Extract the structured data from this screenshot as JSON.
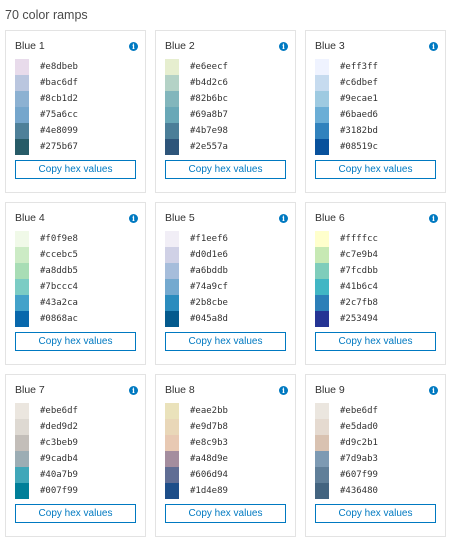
{
  "heading": "70 color ramps",
  "copy_label": "Copy hex values",
  "ramps": [
    {
      "name": "Blue 1",
      "colors": [
        "#e8dbeb",
        "#bac6df",
        "#8cb1d2",
        "#75a6cc",
        "#4e8099",
        "#275b67"
      ]
    },
    {
      "name": "Blue 2",
      "colors": [
        "#e6eecf",
        "#b4d2c6",
        "#82b6bc",
        "#69a8b7",
        "#4b7e98",
        "#2e557a"
      ]
    },
    {
      "name": "Blue 3",
      "colors": [
        "#eff3ff",
        "#c6dbef",
        "#9ecae1",
        "#6baed6",
        "#3182bd",
        "#08519c"
      ]
    },
    {
      "name": "Blue 4",
      "colors": [
        "#f0f9e8",
        "#ccebc5",
        "#a8ddb5",
        "#7bccc4",
        "#43a2ca",
        "#0868ac"
      ]
    },
    {
      "name": "Blue 5",
      "colors": [
        "#f1eef6",
        "#d0d1e6",
        "#a6bddb",
        "#74a9cf",
        "#2b8cbe",
        "#045a8d"
      ]
    },
    {
      "name": "Blue 6",
      "colors": [
        "#ffffcc",
        "#c7e9b4",
        "#7fcdbb",
        "#41b6c4",
        "#2c7fb8",
        "#253494"
      ]
    },
    {
      "name": "Blue 7",
      "colors": [
        "#ebe6df",
        "#ded9d2",
        "#c3beb9",
        "#9cadb4",
        "#40a7b9",
        "#007f99"
      ]
    },
    {
      "name": "Blue 8",
      "colors": [
        "#eae2bb",
        "#e9d7b8",
        "#e8c9b3",
        "#a48d9e",
        "#606d94",
        "#1d4e89"
      ]
    },
    {
      "name": "Blue 9",
      "colors": [
        "#ebe6df",
        "#e5dad0",
        "#d9c2b1",
        "#7d9ab3",
        "#607f99",
        "#436480"
      ]
    }
  ]
}
